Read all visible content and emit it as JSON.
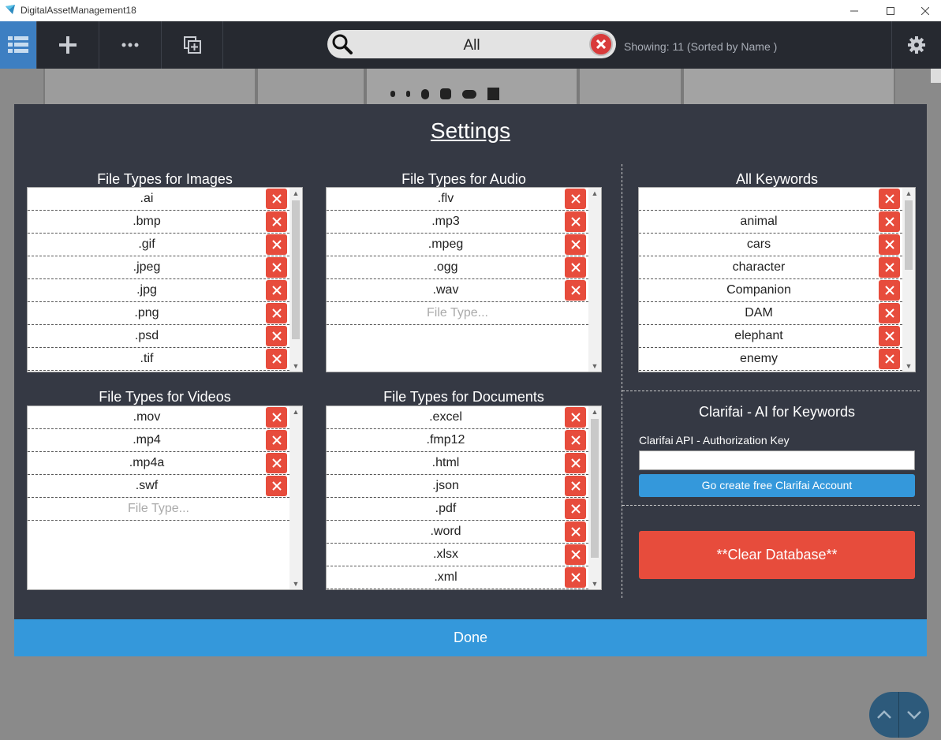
{
  "window": {
    "title": "DigitalAssetManagement18"
  },
  "toolbar": {
    "search_value": "All",
    "showing_text": "Showing: 11 (Sorted by Name )"
  },
  "settings": {
    "title": "Settings",
    "images": {
      "label": "File Types for Images",
      "items": [
        ".ai",
        ".bmp",
        ".gif",
        ".jpeg",
        ".jpg",
        ".png",
        ".psd",
        ".tif"
      ]
    },
    "audio": {
      "label": "File Types for Audio",
      "items": [
        ".flv",
        ".mp3",
        ".mpeg",
        ".ogg",
        ".wav"
      ],
      "placeholder": "File Type..."
    },
    "videos": {
      "label": "File Types for Videos",
      "items": [
        ".mov",
        ".mp4",
        ".mp4a",
        ".swf"
      ],
      "placeholder": "File Type..."
    },
    "documents": {
      "label": "File Types for Documents",
      "items": [
        ".excel",
        ".fmp12",
        ".html",
        ".json",
        ".pdf",
        ".word",
        ".xlsx",
        ".xml"
      ]
    },
    "keywords": {
      "label": "All Keywords",
      "items": [
        "",
        "animal",
        "cars",
        "character",
        "Companion",
        "DAM",
        "elephant",
        "enemy"
      ]
    },
    "clarifai": {
      "title": "Clarifai - AI for Keywords",
      "api_label": "Clarifai API - Authorization Key",
      "api_value": "",
      "create_button": "Go create free Clarifai Account"
    },
    "clear_database": "**Clear Database**",
    "done": "Done"
  },
  "colors": {
    "toolbar_bg": "#262930",
    "modal_bg": "#353944",
    "accent_blue": "#3498db",
    "danger_red": "#e74c3c"
  }
}
